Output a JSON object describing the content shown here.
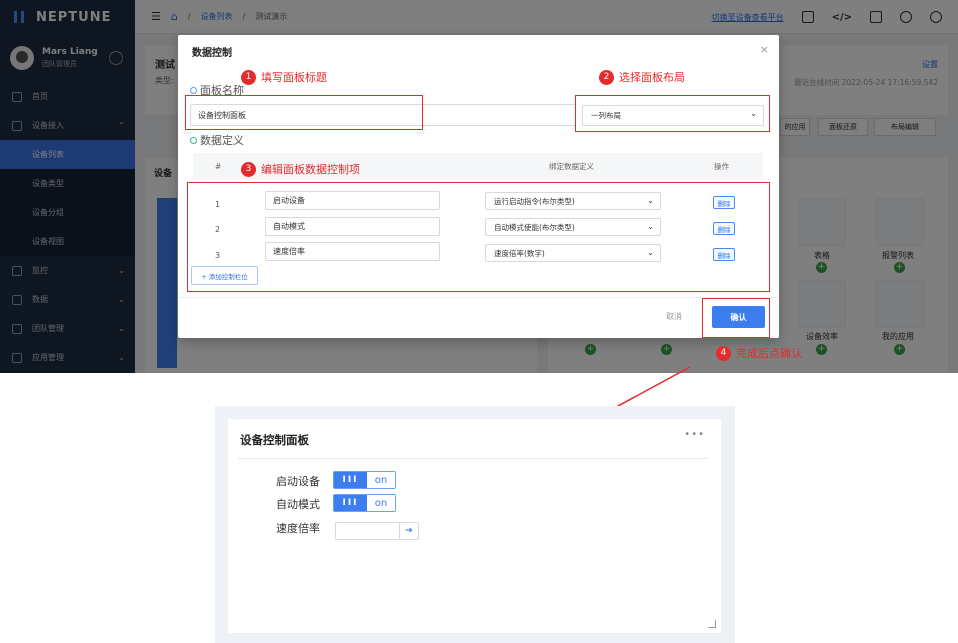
{
  "app": {
    "name": "NEPTUNE"
  },
  "user": {
    "name": "Mars Liang",
    "role": "团队管理员"
  },
  "sidebar": {
    "items": [
      {
        "label": "首页"
      },
      {
        "label": "设备接入"
      },
      {
        "label": "设备列表"
      },
      {
        "label": "设备类型"
      },
      {
        "label": "设备分组"
      },
      {
        "label": "设备视图"
      },
      {
        "label": "监控"
      },
      {
        "label": "数据"
      },
      {
        "label": "团队管理"
      },
      {
        "label": "应用管理"
      }
    ]
  },
  "topbar": {
    "breadcrumb": [
      "设备列表",
      "测试演示"
    ],
    "switch_link": "切换至设备查看平台"
  },
  "background": {
    "page_title": "测试",
    "type_label": "类型:",
    "settings_link": "设置",
    "last_online": "最近在线时间 2022-05-24 17:16:59.542",
    "btn_app": "的应用",
    "btn_restore": "面板还原",
    "btn_layout": "布局编辑",
    "panel_title": "设备",
    "cards": [
      "表格",
      "报警列表",
      "设备效率",
      "我的应用"
    ]
  },
  "modal": {
    "title": "数据控制",
    "close": "×",
    "section_name": "面板名称",
    "title_value": "设备控制面板",
    "layout_value": "一列布局",
    "section_def": "数据定义",
    "table_headers": {
      "index": "#",
      "binding": "绑定数据定义",
      "action": "操作"
    },
    "rows": [
      {
        "index": "1",
        "name": "启动设备",
        "binding": "运行启动指令(布尔类型)",
        "action": "删除"
      },
      {
        "index": "2",
        "name": "自动模式",
        "binding": "自动模式使能(布尔类型)",
        "action": "删除"
      },
      {
        "index": "3",
        "name": "速度倍率",
        "binding": "速度倍率(数字)",
        "action": "删除"
      }
    ],
    "add_button": "+ 添加控制栏位",
    "cancel": "取消",
    "confirm": "确认"
  },
  "annotations": [
    {
      "num": "1",
      "text": "填写面板标题"
    },
    {
      "num": "2",
      "text": "选择面板布局"
    },
    {
      "num": "3",
      "text": "编辑面板数据控制项"
    },
    {
      "num": "4",
      "text": "完成后点确认"
    }
  ],
  "result_panel": {
    "title": "设备控制面板",
    "menu": "•••",
    "controls": [
      {
        "label": "启动设备",
        "on_text": "III",
        "state": "on"
      },
      {
        "label": "自动模式",
        "on_text": "III",
        "state": "on"
      },
      {
        "label": "速度倍率"
      }
    ]
  },
  "colors": {
    "accent": "#3c7ef0",
    "annotation": "#e52b2b",
    "sidebar": "#1d2d44"
  }
}
